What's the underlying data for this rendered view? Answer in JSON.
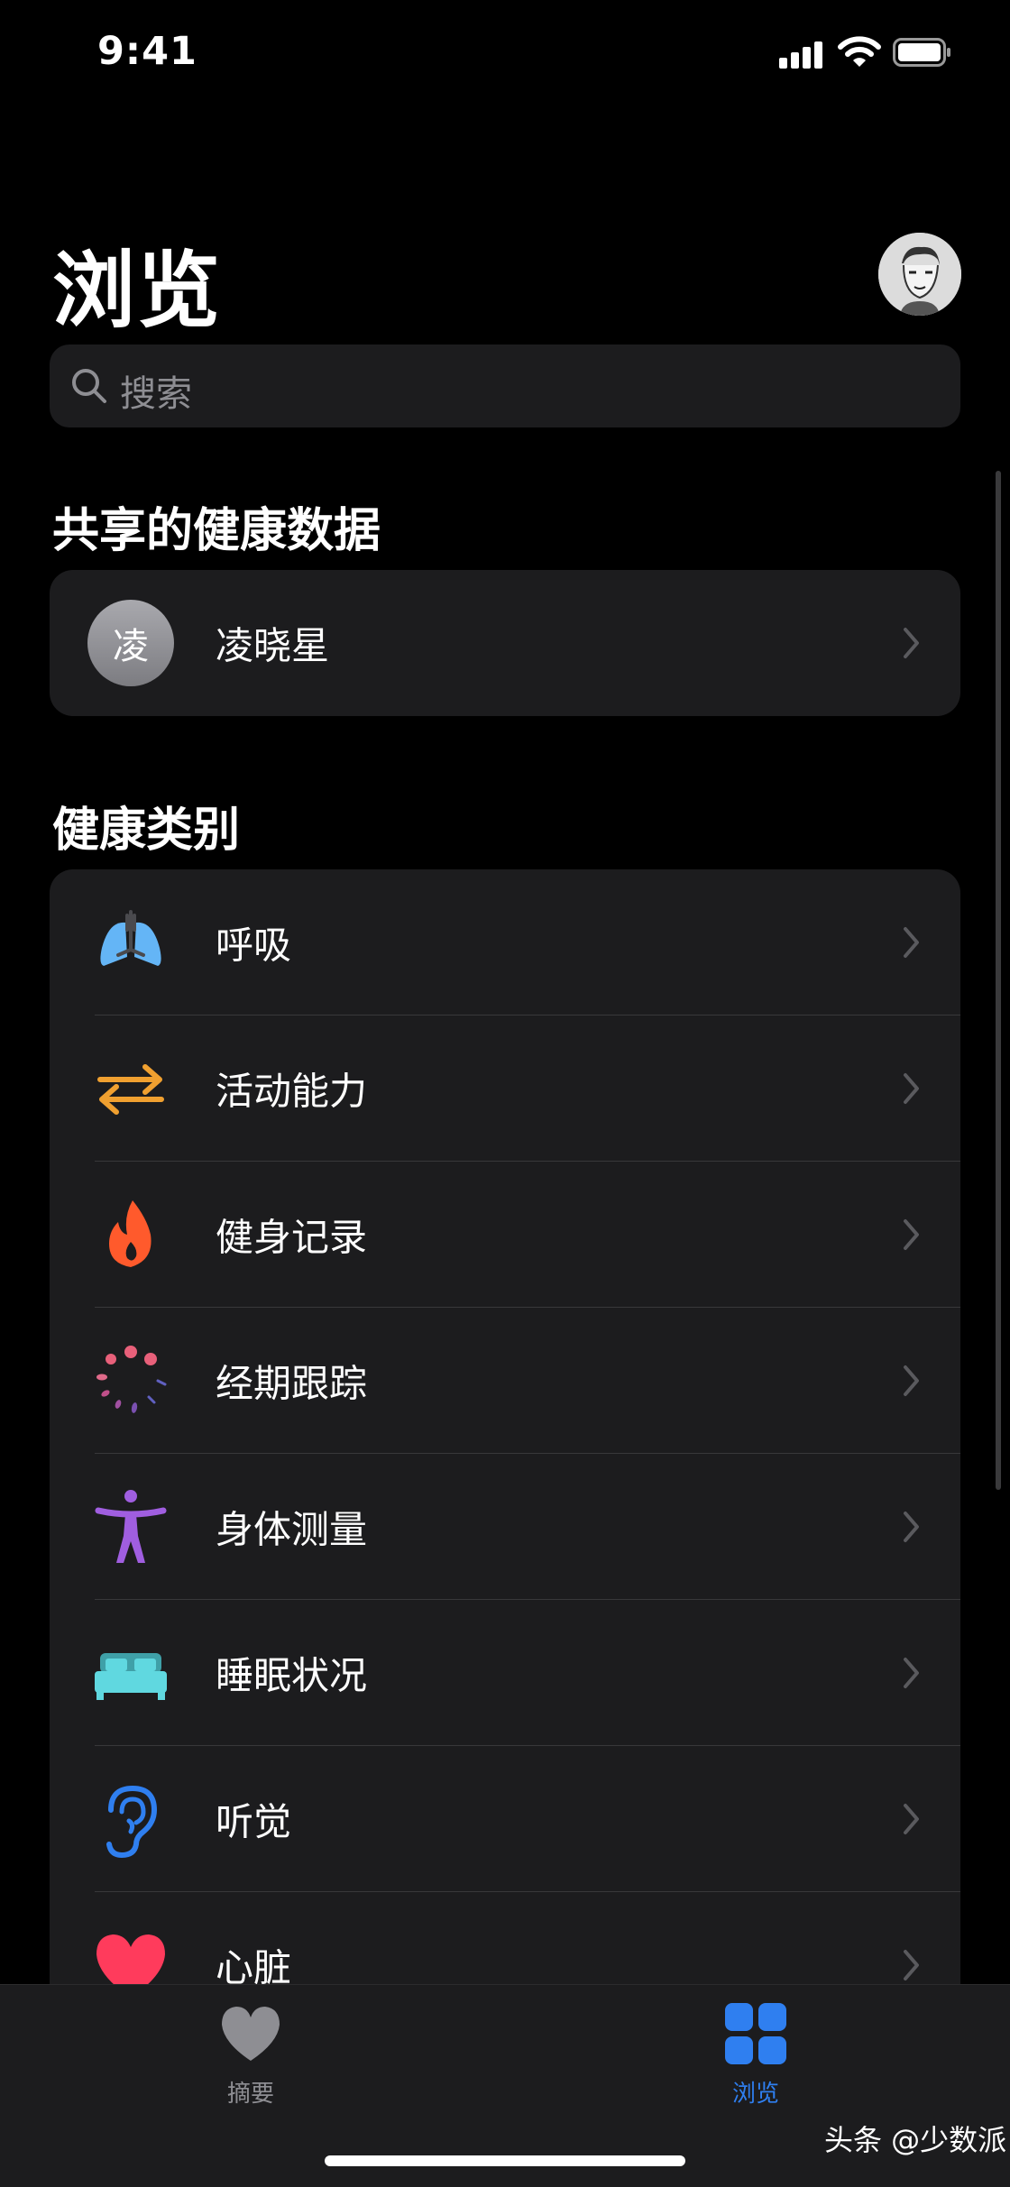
{
  "status": {
    "time": "9:41"
  },
  "header": {
    "title": "浏览"
  },
  "search": {
    "placeholder": "搜索"
  },
  "shared": {
    "title": "共享的健康数据",
    "person_initial": "凌",
    "person_name": "凌晓星"
  },
  "categories": {
    "title": "健康类别",
    "items": [
      {
        "label": "呼吸",
        "icon": "lungs-icon",
        "color": "#64b5f6"
      },
      {
        "label": "活动能力",
        "icon": "arrows-icon",
        "color": "#f0a030"
      },
      {
        "label": "健身记录",
        "icon": "flame-icon",
        "color": "#ff5a2c"
      },
      {
        "label": "经期跟踪",
        "icon": "cycle-icon",
        "color": "#e8607a"
      },
      {
        "label": "身体测量",
        "icon": "figure-icon",
        "color": "#a05ee0"
      },
      {
        "label": "睡眠状况",
        "icon": "bed-icon",
        "color": "#60d8e0"
      },
      {
        "label": "听觉",
        "icon": "ear-icon",
        "color": "#2f7ff0"
      },
      {
        "label": "心脏",
        "icon": "heart-icon",
        "color": "#ff3b5c"
      }
    ]
  },
  "tabbar": {
    "summary_label": "摘要",
    "browse_label": "浏览",
    "active_color": "#2f7ff0"
  },
  "watermark": "头条 @少数派"
}
